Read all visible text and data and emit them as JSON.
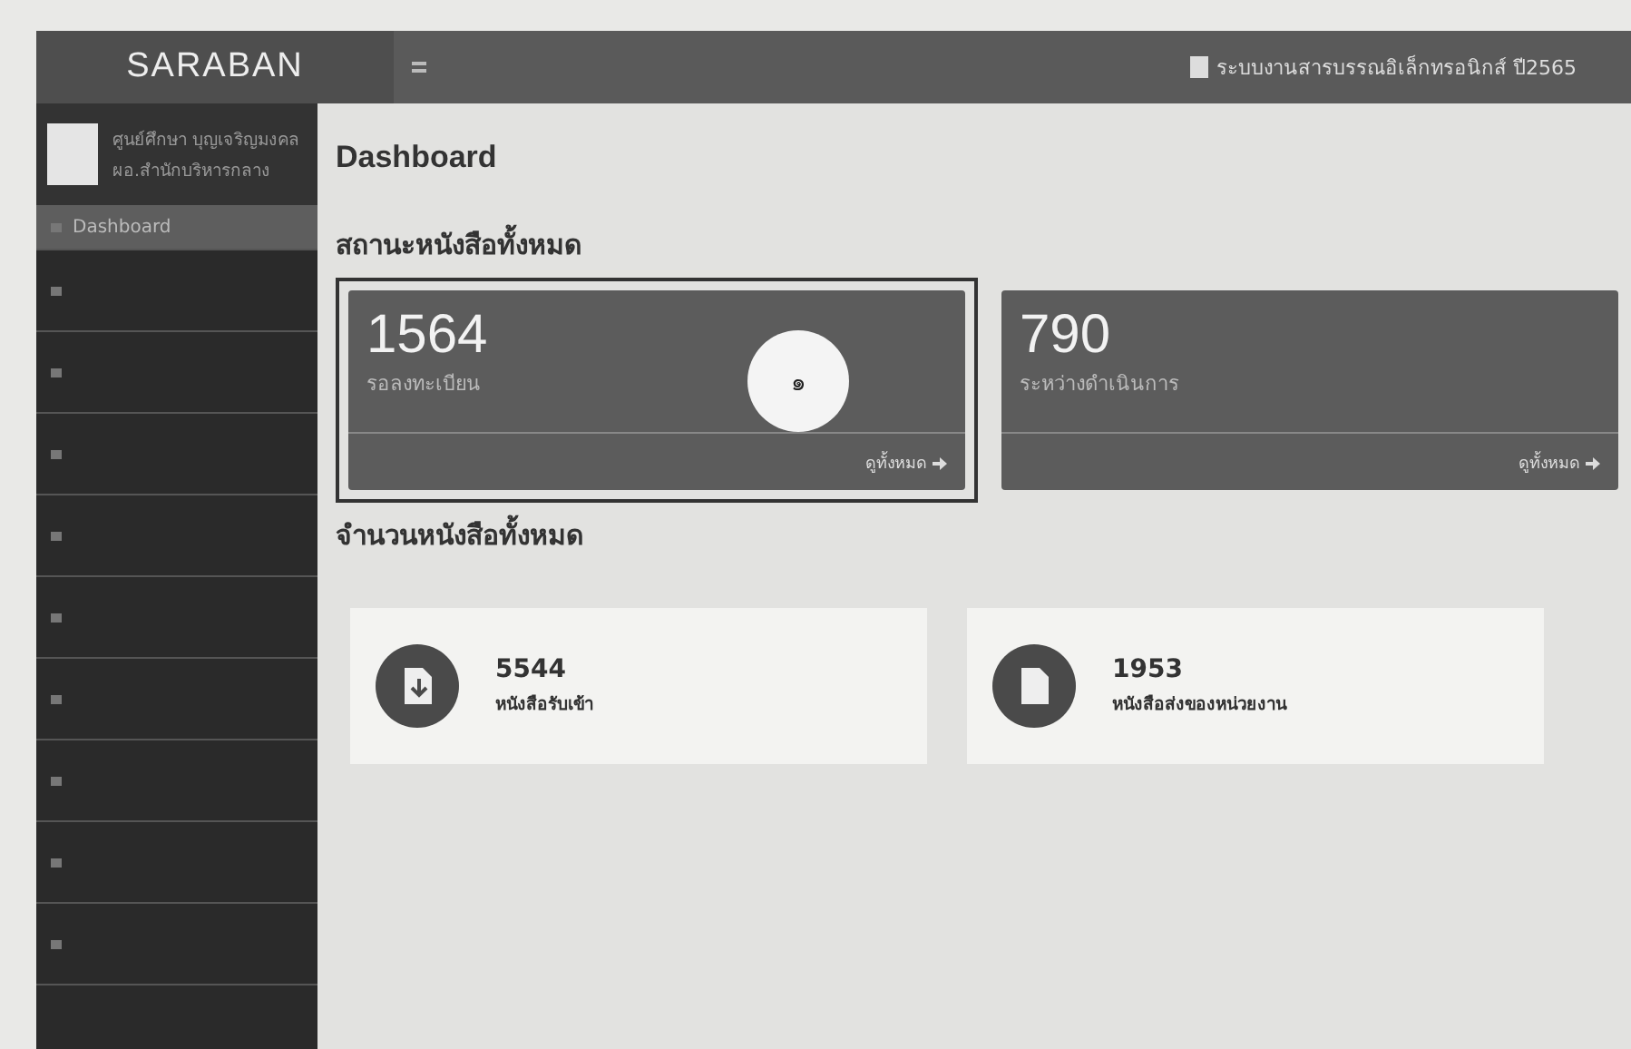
{
  "brand": "SARABAN",
  "header": {
    "title": "ระบบงานสารบรรณอิเล็กทรอนิกส์ ปี2565"
  },
  "user": {
    "name": "ศูนย์ศึกษา บุญเจริญมงคล",
    "position": "ผอ.สำนักบริหารกลาง"
  },
  "sidebar": {
    "items": [
      {
        "label": "Dashboard",
        "selected": true
      },
      {
        "selected": false
      },
      {
        "selected": false
      },
      {
        "selected": false
      },
      {
        "selected": false
      },
      {
        "selected": false
      },
      {
        "selected": false
      },
      {
        "selected": false
      },
      {
        "selected": false
      },
      {
        "selected": false
      }
    ]
  },
  "page_title": "Dashboard",
  "status_section": {
    "title": "สถานะหนังสือทั้งหมด",
    "cards": [
      {
        "count": "1564",
        "label": "รอลงทะเบียน",
        "link": "ดูทั้งหมด",
        "highlighted": true
      },
      {
        "count": "790",
        "label": "ระหว่างดำเนินการ",
        "link": "ดูทั้งหมด",
        "highlighted": false
      }
    ]
  },
  "annotation": {
    "text": "๑"
  },
  "total_section": {
    "title": "จำนวนหนังสือทั้งหมด",
    "items": [
      {
        "count": "5544",
        "label": "หนังสือรับเข้า",
        "kind": "incoming"
      },
      {
        "count": "1953",
        "label": "หนังสือส่งของหน่วยงาน",
        "kind": "outgoing"
      }
    ]
  }
}
